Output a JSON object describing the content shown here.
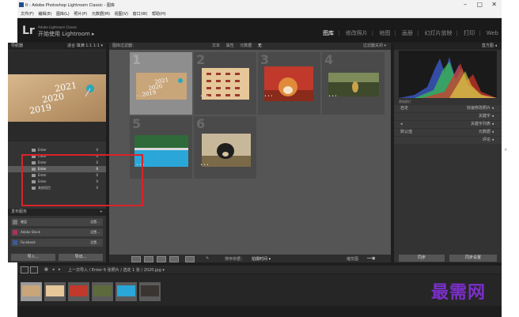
{
  "window": {
    "title": "lt - Adobe Photoshop Lightroom Classic - 图库",
    "controls": {
      "minimize": "–",
      "maximize": "▢",
      "close": "✕"
    }
  },
  "menu": [
    "文件(F)",
    "编辑(E)",
    "图库(L)",
    "照片(P)",
    "元数据(M)",
    "视图(V)",
    "窗口(W)",
    "帮助(H)"
  ],
  "identity": {
    "logo": "Lr",
    "subtitle": "Adobe Lightroom Classic",
    "name": "开始使用 Lightroom ▸"
  },
  "modules": [
    "图库",
    "修改照片",
    "地图",
    "画册",
    "幻灯片放映",
    "打印",
    "Web"
  ],
  "active_module": "图库",
  "left_panel": {
    "navigator_header": "导航器",
    "navigator_options": "适合  填满  1:1  1:1 ▾",
    "folders": [
      {
        "label": "Enter",
        "count": "0"
      },
      {
        "label": "Clear",
        "count": "0"
      },
      {
        "label": "Enter",
        "count": "0"
      },
      {
        "label": "Enter",
        "count": "6"
      },
      {
        "label": "Enter",
        "count": "0"
      },
      {
        "label": "Enter",
        "count": "0"
      },
      {
        "label": "其他项目",
        "count": "0"
      }
    ],
    "selected_folder_index": 3,
    "publish_header": "发布服务",
    "publish_rows": [
      {
        "label": "硬盘",
        "right": "设置..."
      },
      {
        "label": "Adobe Stock",
        "right": "设置..."
      },
      {
        "label": "Facebook",
        "right": "设置..."
      }
    ],
    "import_button": "导入...",
    "export_button": "导出..."
  },
  "filter_bar": {
    "title": "图库过滤器：",
    "options": [
      "文本",
      "属性",
      "元数据",
      "无"
    ],
    "filter_label": "过滤器关闭 ▾"
  },
  "grid": {
    "cells": [
      {
        "number": "1",
        "dots": "•••"
      },
      {
        "number": "2",
        "dots": "•••"
      },
      {
        "number": "3",
        "dots": "•••"
      },
      {
        "number": "4",
        "dots": "•••"
      },
      {
        "number": "5",
        "dots": "•••"
      },
      {
        "number": "6",
        "dots": "•••"
      }
    ],
    "selected_index": 0
  },
  "toolbar": {
    "sort_label": "排序依据：",
    "sort_value": "拍摄时间 ▾",
    "thumbnails": "缩览图"
  },
  "right_panel": {
    "histogram_header": "直方图 ◂",
    "histogram_info": "原始照片",
    "rows": [
      {
        "left": "自定",
        "right": "快速修改照片 ◂"
      },
      {
        "left": "",
        "right": "关键字 ◂"
      },
      {
        "left": "◂",
        "right": "关键字列表 ◂"
      },
      {
        "left": "默认值",
        "right": "元数据 ◂"
      },
      {
        "left": "",
        "right": "评论 ◂"
      }
    ],
    "sync_button": "同步",
    "sync_settings_button": "同步设置"
  },
  "filmstrip_bar": {
    "path": "上一次导入 / Enter  6 张照片 / 选定 1 张 / 2020.jpg ▾",
    "filter": "过滤器：",
    "filter_value": "关闭过滤器"
  },
  "watermark": "最需网",
  "colors": {
    "annotation_red": "#d9232a",
    "watermark_purple": "#7b2fc9",
    "panel_bg": "#333333",
    "grid_bg": "#555555"
  }
}
